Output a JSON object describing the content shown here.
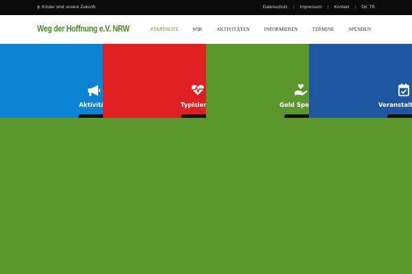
{
  "topbar": {
    "tagline": "Kinder sind unsere Zukunft.",
    "links": [
      "Datenschutz",
      "Impressum",
      "Kontakt",
      "Dil: TR"
    ]
  },
  "header": {
    "logo": "Weg der Hoffnung e.V. NRW",
    "nav": [
      {
        "label": "STARTSEITE",
        "active": true
      },
      {
        "label": "WIR",
        "active": false
      },
      {
        "label": "AKTIVITÄTEN",
        "active": false
      },
      {
        "label": "INFORMIEREN",
        "active": false
      },
      {
        "label": "TERMINE",
        "active": false
      },
      {
        "label": "SPENDEN",
        "active": false
      }
    ]
  },
  "tiles": [
    {
      "label": "Aktivitäten",
      "icon": "megaphone-icon",
      "color": "#0a84d2"
    },
    {
      "label": "Typisierung",
      "icon": "heartbeat-icon",
      "color": "#e02020"
    },
    {
      "label": "Geld Spenden",
      "icon": "hand-heart-icon",
      "color": "#5c972c"
    },
    {
      "label": "Veranstaltungen",
      "icon": "calendar-check-icon",
      "color": "#1e56a0"
    }
  ],
  "colors": {
    "brand_green": "#5c972c",
    "topbar_bg": "#0b0b0b",
    "header_bg": "#ffffff"
  }
}
